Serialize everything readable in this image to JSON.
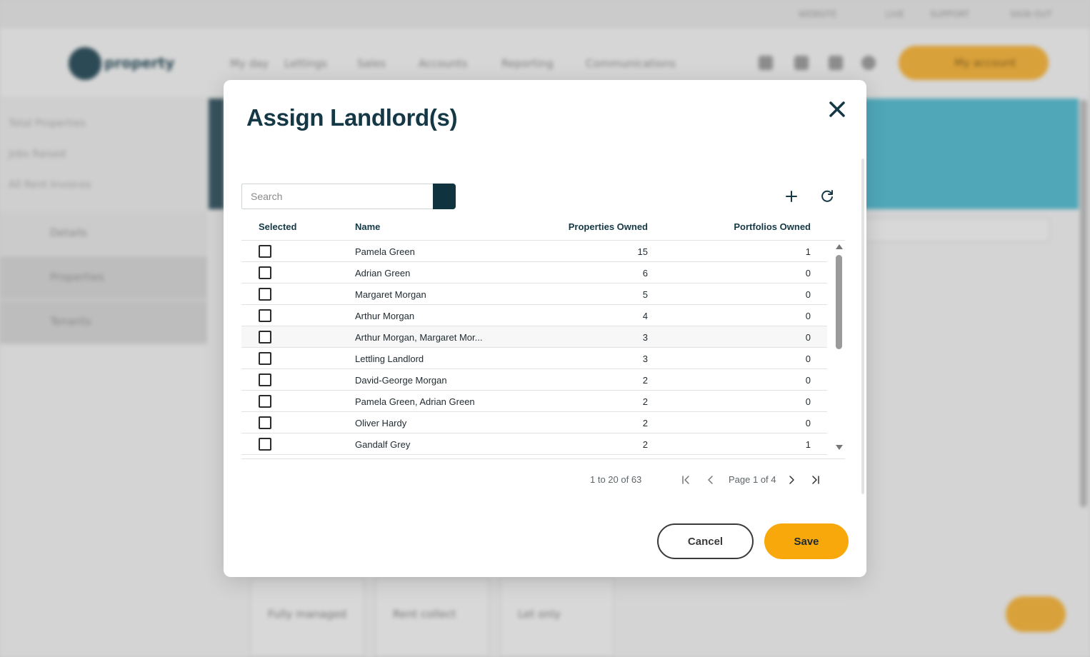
{
  "background": {
    "top_links": [
      "WEBSITE",
      "LIVE",
      "SUPPORT",
      "SIGN OUT"
    ],
    "logo_text": "property",
    "nav": [
      "My day",
      "Lettings",
      "Sales",
      "Accounts",
      "Reporting",
      "Communications"
    ],
    "account_label": "My account",
    "stats": [
      "Total Properties",
      "Jobs Raised",
      "All Rent Invoices"
    ],
    "side_nav": [
      "Details",
      "Properties",
      "Tenants"
    ],
    "cards": [
      "Fully managed",
      "Rent collect",
      "Let only"
    ]
  },
  "modal": {
    "title": "Assign Landlord(s)",
    "search_placeholder": "Search",
    "columns": {
      "selected": "Selected",
      "name": "Name",
      "properties": "Properties Owned",
      "portfolios": "Portfolios Owned"
    },
    "rows": [
      {
        "name": "Pamela Green",
        "properties": "15",
        "portfolios": "1"
      },
      {
        "name": "Adrian Green",
        "properties": "6",
        "portfolios": "0"
      },
      {
        "name": "Margaret Morgan",
        "properties": "5",
        "portfolios": "0"
      },
      {
        "name": "Arthur Morgan",
        "properties": "4",
        "portfolios": "0"
      },
      {
        "name": "Arthur Morgan, Margaret Mor...",
        "properties": "3",
        "portfolios": "0"
      },
      {
        "name": "Lettling Landlord",
        "properties": "3",
        "portfolios": "0"
      },
      {
        "name": "David-George Morgan",
        "properties": "2",
        "portfolios": "0"
      },
      {
        "name": "Pamela Green, Adrian Green",
        "properties": "2",
        "portfolios": "0"
      },
      {
        "name": "Oliver Hardy",
        "properties": "2",
        "portfolios": "0"
      },
      {
        "name": "Gandalf Grey",
        "properties": "2",
        "portfolios": "1"
      }
    ],
    "pagination": {
      "summary": "1 to 20 of 63",
      "page_label": "Page 1 of 4"
    },
    "buttons": {
      "cancel": "Cancel",
      "save": "Save"
    }
  },
  "colors": {
    "primary_dark": "#0f3440",
    "accent": "#f9a80b"
  }
}
